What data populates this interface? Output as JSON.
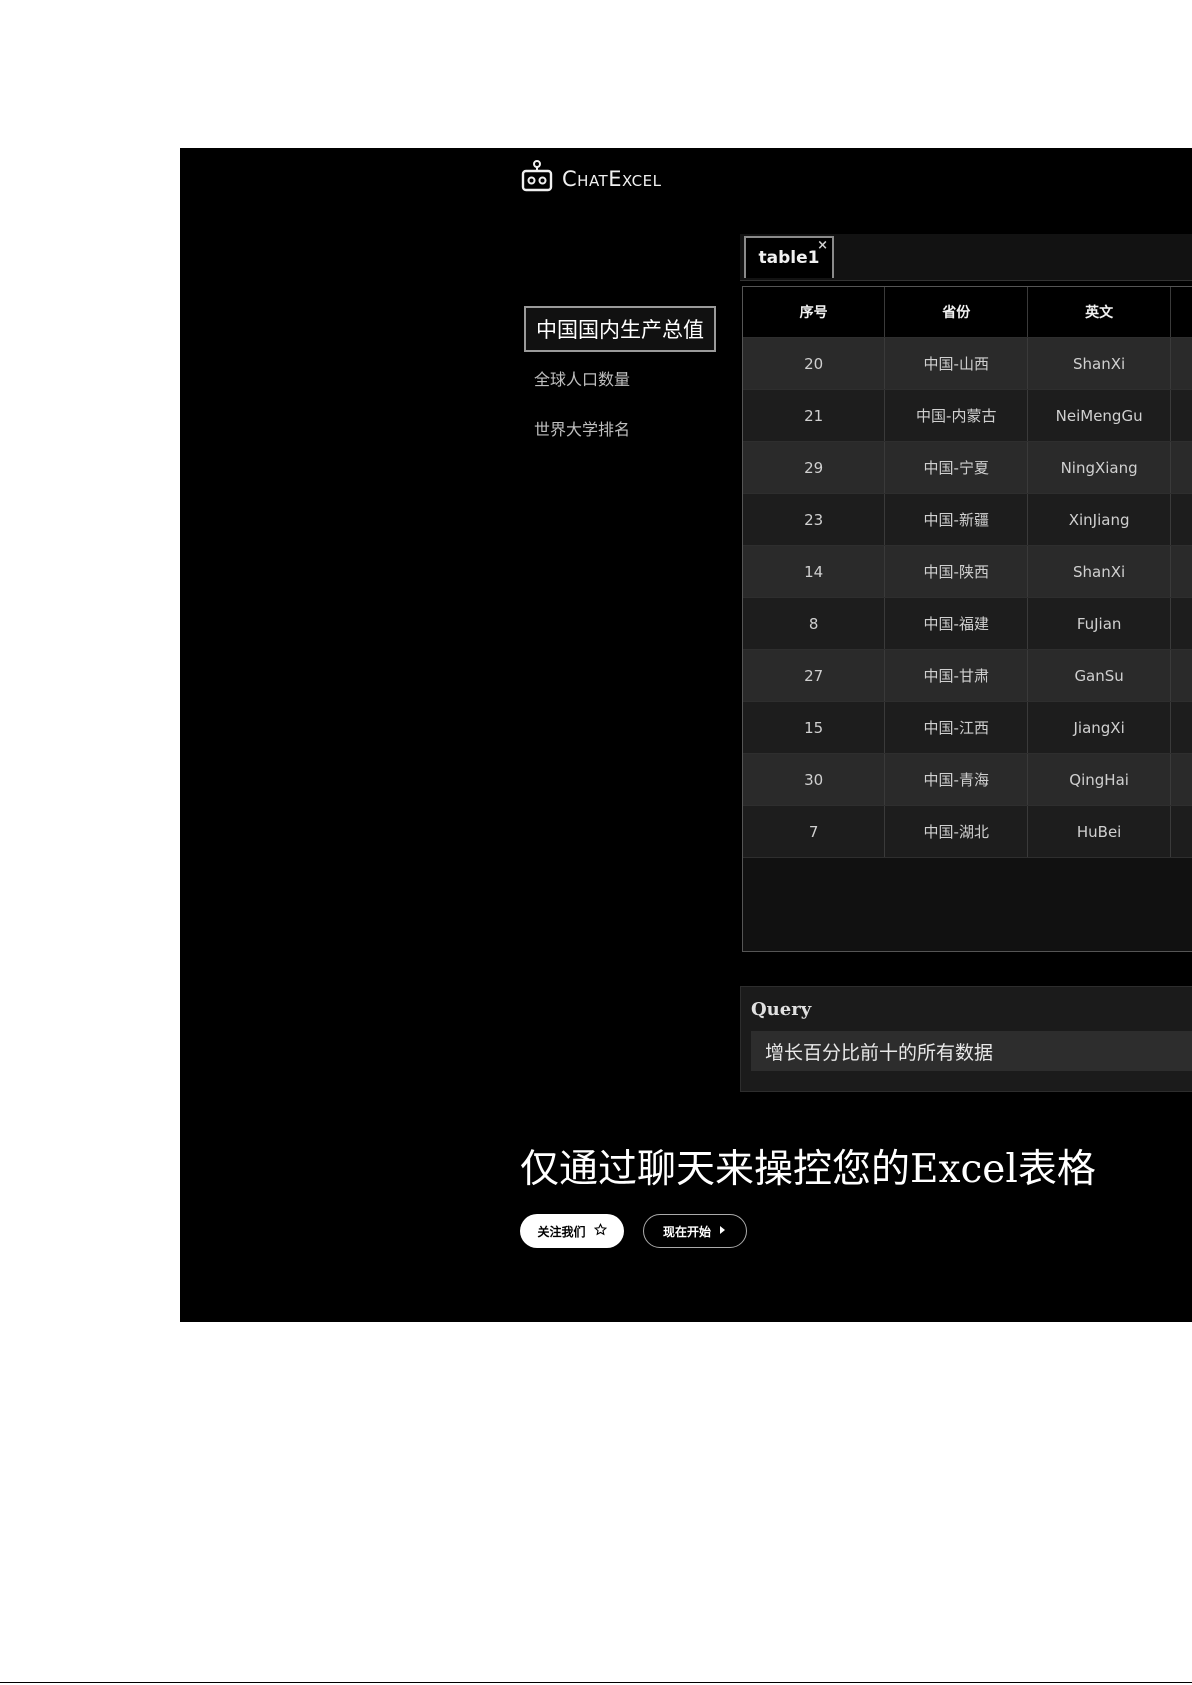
{
  "app": {
    "logo_text": "ChatExcel"
  },
  "nav": {
    "items": [
      {
        "label": "中国国内生产总值",
        "active": true
      },
      {
        "label": "全球人口数量",
        "active": false
      },
      {
        "label": "世界大学排名",
        "active": false
      }
    ]
  },
  "tabs": [
    {
      "label": "table1",
      "close": "×"
    }
  ],
  "table": {
    "headers": [
      "序号",
      "省份",
      "英文"
    ],
    "rows": [
      [
        "20",
        "中国-山西",
        "ShanXi"
      ],
      [
        "21",
        "中国-内蒙古",
        "NeiMengGu"
      ],
      [
        "29",
        "中国-宁夏",
        "NingXiang"
      ],
      [
        "23",
        "中国-新疆",
        "XinJiang"
      ],
      [
        "14",
        "中国-陕西",
        "ShanXi"
      ],
      [
        "8",
        "中国-福建",
        "FuJian"
      ],
      [
        "27",
        "中国-甘肃",
        "GanSu"
      ],
      [
        "15",
        "中国-江西",
        "JiangXi"
      ],
      [
        "30",
        "中国-青海",
        "QingHai"
      ],
      [
        "7",
        "中国-湖北",
        "HuBei"
      ]
    ]
  },
  "query": {
    "label": "Query",
    "value": "增长百分比前十的所有数据"
  },
  "hero": {
    "headline": "仅通过聊天来操控您的Excel表格"
  },
  "buttons": {
    "follow_label": "关注我们",
    "follow_icon": "star-outline-icon",
    "start_label": "现在开始",
    "start_icon": "caret-right-icon"
  }
}
